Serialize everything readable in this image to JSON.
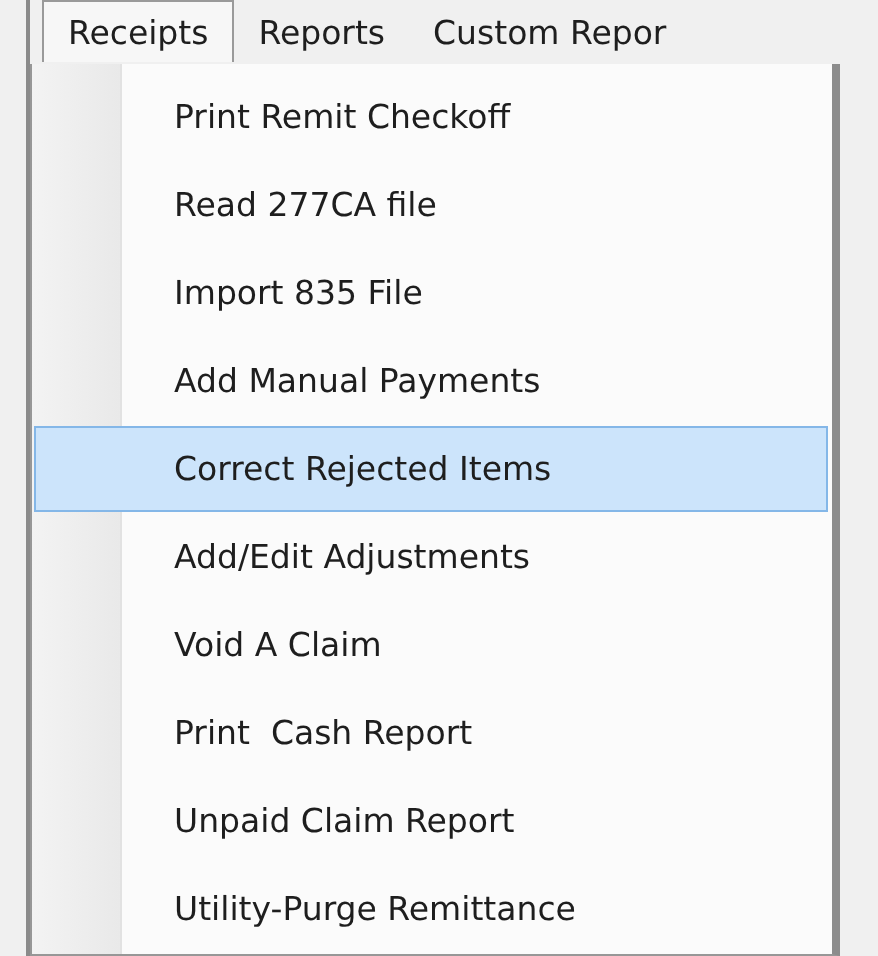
{
  "menu_bar": [
    {
      "label": "Receipts",
      "selected": true
    },
    {
      "label": "Reports",
      "selected": false
    },
    {
      "label": "Custom Repor",
      "selected": false
    }
  ],
  "dropdown": {
    "items": [
      {
        "label": "Print Remit Checkoff",
        "selected": false
      },
      {
        "label": "Read 277CA file",
        "selected": false
      },
      {
        "label": "Import 835 File",
        "selected": false
      },
      {
        "label": "Add Manual Payments",
        "selected": false
      },
      {
        "label": "Correct Rejected Items",
        "selected": true
      },
      {
        "label": "Add/Edit Adjustments",
        "selected": false
      },
      {
        "label": "Void A Claim",
        "selected": false
      },
      {
        "label": "Print  Cash Report",
        "selected": false
      },
      {
        "label": "Unpaid Claim Report",
        "selected": false
      },
      {
        "label": "Utility-Purge Remittance",
        "selected": false
      }
    ]
  }
}
